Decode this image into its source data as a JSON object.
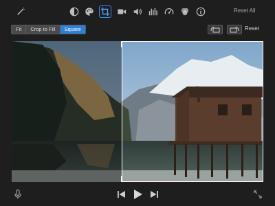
{
  "toolbar": {
    "icons": [
      {
        "name": "magic-wand-icon"
      },
      {
        "name": "color-balance-icon"
      },
      {
        "name": "color-palette-icon"
      },
      {
        "name": "crop-icon",
        "selected": true
      },
      {
        "name": "video-camera-icon"
      },
      {
        "name": "volume-icon"
      },
      {
        "name": "equalizer-icon"
      },
      {
        "name": "speedometer-icon"
      },
      {
        "name": "filter-icon"
      },
      {
        "name": "info-icon"
      }
    ],
    "reset_all_label": "Reset All"
  },
  "crop_controls": {
    "modes": [
      {
        "label": "Fit",
        "active": false
      },
      {
        "label": "Crop to Fill",
        "active": false
      },
      {
        "label": "Square",
        "active": true
      }
    ],
    "rotate_left_icon": "rotate-left-icon",
    "rotate_right_icon": "rotate-right-icon",
    "reset_label": "Reset"
  },
  "transport": {
    "microphone_icon": "microphone-icon",
    "previous_icon": "skip-back-icon",
    "play_icon": "play-icon",
    "next_icon": "skip-forward-icon",
    "fullscreen_icon": "fullscreen-icon"
  },
  "colors": {
    "background": "#1e1e1f",
    "accent": "#2e7fd6",
    "button": "#4a4a4b"
  }
}
